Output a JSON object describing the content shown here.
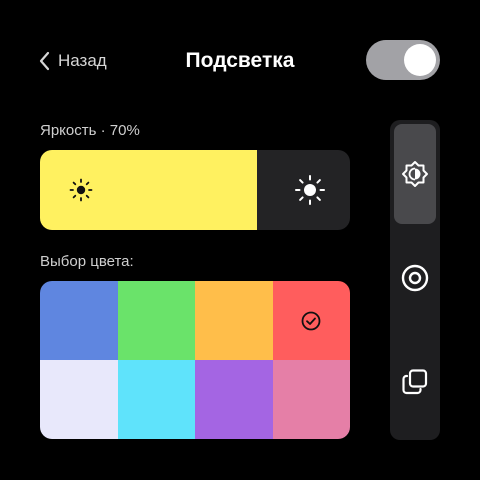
{
  "header": {
    "back_label": "Назад",
    "title": "Подсветка",
    "toggle_on": true
  },
  "brightness": {
    "label": "Яркость · 70%",
    "value_percent": 70
  },
  "color_picker": {
    "label": "Выбор цвета:",
    "swatches": [
      {
        "color": "#5f86e0",
        "selected": false
      },
      {
        "color": "#6ae36a",
        "selected": false
      },
      {
        "color": "#ffbe4a",
        "selected": false
      },
      {
        "color": "#ff5d5d",
        "selected": true
      },
      {
        "color": "#e8e8fb",
        "selected": false
      },
      {
        "color": "#5fe3fb",
        "selected": false
      },
      {
        "color": "#a465e3",
        "selected": false
      },
      {
        "color": "#e57fa7",
        "selected": false
      }
    ]
  },
  "side_panel": {
    "modes": [
      {
        "icon": "auto-brightness-icon",
        "active": true
      },
      {
        "icon": "stop-circle-icon",
        "active": false
      },
      {
        "icon": "copy-icon",
        "active": false
      }
    ]
  },
  "colors": {
    "background": "#000000",
    "brightness_fill": "#fff160",
    "panel": "#1e1e20",
    "toggle_track": "#a2a2a6"
  }
}
